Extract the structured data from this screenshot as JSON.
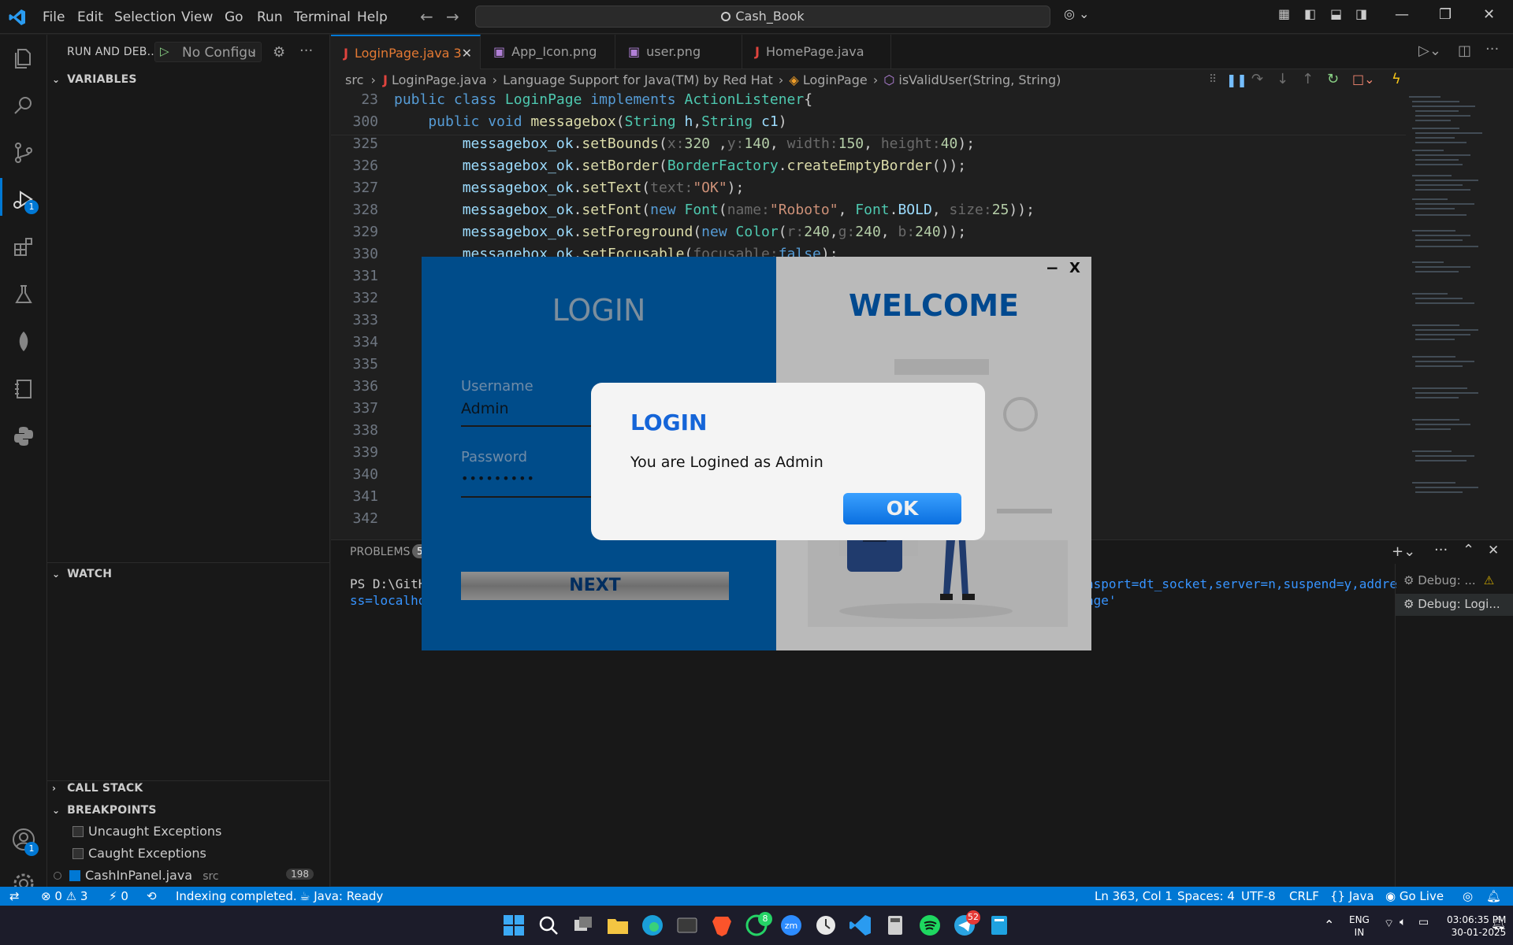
{
  "titlebar": {
    "menu": [
      "File",
      "Edit",
      "Selection",
      "View",
      "Go",
      "Run",
      "Terminal",
      "Help"
    ],
    "search": "Cash_Book"
  },
  "activity": {
    "debug_badge": "1",
    "account_badge": "1"
  },
  "sidebar": {
    "title": "RUN AND DEB...",
    "config": "No Configu",
    "variables": "VARIABLES",
    "watch": "WATCH",
    "callstack": "CALL STACK",
    "breakpoints": "BREAKPOINTS",
    "bp_items": [
      {
        "label": "Uncaught Exceptions",
        "checked": false
      },
      {
        "label": "Caught Exceptions",
        "checked": false
      },
      {
        "label": "CashInPanel.java",
        "path": "src",
        "count": "198",
        "checked": true
      }
    ]
  },
  "tabs": [
    {
      "label": "LoginPage.java 3",
      "icon": "java-icon",
      "active": true
    },
    {
      "label": "App_Icon.png",
      "icon": "image-icon",
      "active": false
    },
    {
      "label": "user.png",
      "icon": "image-icon",
      "active": false
    },
    {
      "label": "HomePage.java",
      "icon": "java-icon",
      "active": false
    }
  ],
  "breadcrumbs": {
    "src": "src",
    "file": "LoginPage.java",
    "ext": "Language Support for Java(TM) by Red Hat",
    "cls": "LoginPage",
    "method": "isValidUser(String, String)"
  },
  "code": {
    "sticky": [
      {
        "n": "23",
        "text": "public class LoginPage implements ActionListener{"
      },
      {
        "n": "300",
        "text": "    public void messagebox(String h,String c1)"
      }
    ],
    "lines": [
      {
        "n": "325",
        "text": "        messagebox_ok.setBounds(x:320 ,y:140, width:150, height:40);"
      },
      {
        "n": "326",
        "text": "        messagebox_ok.setBorder(BorderFactory.createEmptyBorder());"
      },
      {
        "n": "327",
        "text": "        messagebox_ok.setText(text:\"OK\");"
      },
      {
        "n": "328",
        "text": "        messagebox_ok.setFont(new Font(name:\"Roboto\", Font.BOLD, size:25));"
      },
      {
        "n": "329",
        "text": "        messagebox_ok.setForeground(new Color(r:240,g:240, b:240));"
      },
      {
        "n": "330",
        "text": "        messagebox_ok.setFocusable(focusable:false);"
      },
      {
        "n": "331",
        "text": ""
      },
      {
        "n": "332",
        "text": ""
      },
      {
        "n": "333",
        "text": ""
      },
      {
        "n": "334",
        "text": ""
      },
      {
        "n": "335",
        "text": ""
      },
      {
        "n": "336",
        "text": ""
      },
      {
        "n": "337",
        "text": ""
      },
      {
        "n": "338",
        "text": ""
      },
      {
        "n": "339",
        "text": ""
      },
      {
        "n": "340",
        "text": ""
      },
      {
        "n": "341",
        "text": ""
      },
      {
        "n": "342",
        "text": ""
      }
    ]
  },
  "panel": {
    "problems": "PROBLEMS",
    "problems_count": "5",
    "term1": "PS D:\\GitH",
    "term2": "ss=localho",
    "term3": "nsport=dt_socket,server=n,suspend=y,addre",
    "term4": "age'",
    "debug_sessions": [
      "Debug: ...",
      "Debug: Logi..."
    ]
  },
  "statusbar": {
    "errors": "0",
    "warnings": "3",
    "ports": "0",
    "indexing": "Indexing completed.",
    "java": "Java: Ready",
    "position": "Ln 363, Col 1",
    "spaces": "Spaces: 4",
    "encoding": "UTF-8",
    "eol": "CRLF",
    "lang": "Java",
    "golive": "Go Live"
  },
  "taskbar": {
    "whatsapp_badge": "8",
    "telegram_badge": "52",
    "lang1": "ENG",
    "lang2": "IN",
    "time": "03:06:35 PM",
    "date": "30-01-2025"
  },
  "app": {
    "login_title": "LOGIN",
    "welcome_title": "WELCOME",
    "username_label": "Username",
    "username_value": "Admin",
    "password_label": "Password",
    "password_value": "•••••••••",
    "next_label": "NEXT",
    "min_label": "−",
    "close_label": "X"
  },
  "dialog": {
    "title": "LOGIN",
    "message": "You are Logined as Admin",
    "ok_label": "OK"
  },
  "colors": {
    "accent": "#0078d4",
    "app_blue": "#0062b1",
    "dialog_title": "#1565d8",
    "ok_button": "#1f8cf0"
  }
}
